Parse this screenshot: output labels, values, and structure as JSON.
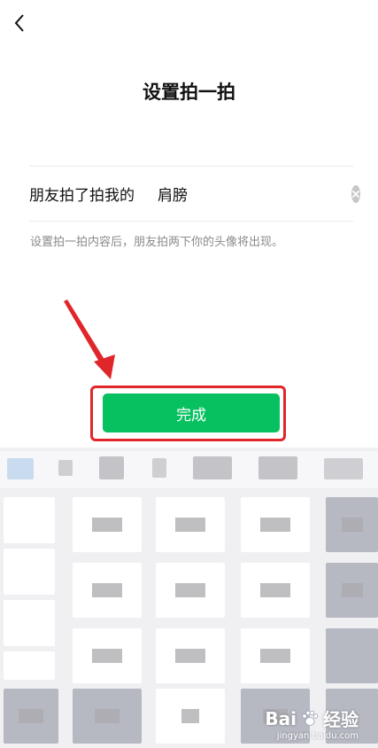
{
  "header": {
    "back_icon": "chevron-left-icon",
    "title": "设置拍一拍"
  },
  "pat_setting": {
    "prefix_label": "朋友拍了拍我的",
    "input_value": "肩膀",
    "clear_icon": "clear-circle-icon",
    "hint": "设置拍一拍内容后，朋友拍两下你的头像将出现。"
  },
  "actions": {
    "done_label": "完成"
  },
  "annotation": {
    "arrow_color": "#e0262b",
    "frame_color": "#e0262b"
  },
  "watermark": {
    "logo_text": "Bai",
    "logo_text_2": "经验",
    "paw_icon": "baidu-paw-icon",
    "url": "jingyan.baidu.com"
  },
  "colors": {
    "accent": "#07c160",
    "background": "#ffffff",
    "keyboard_bg": "#f0f0f3"
  }
}
